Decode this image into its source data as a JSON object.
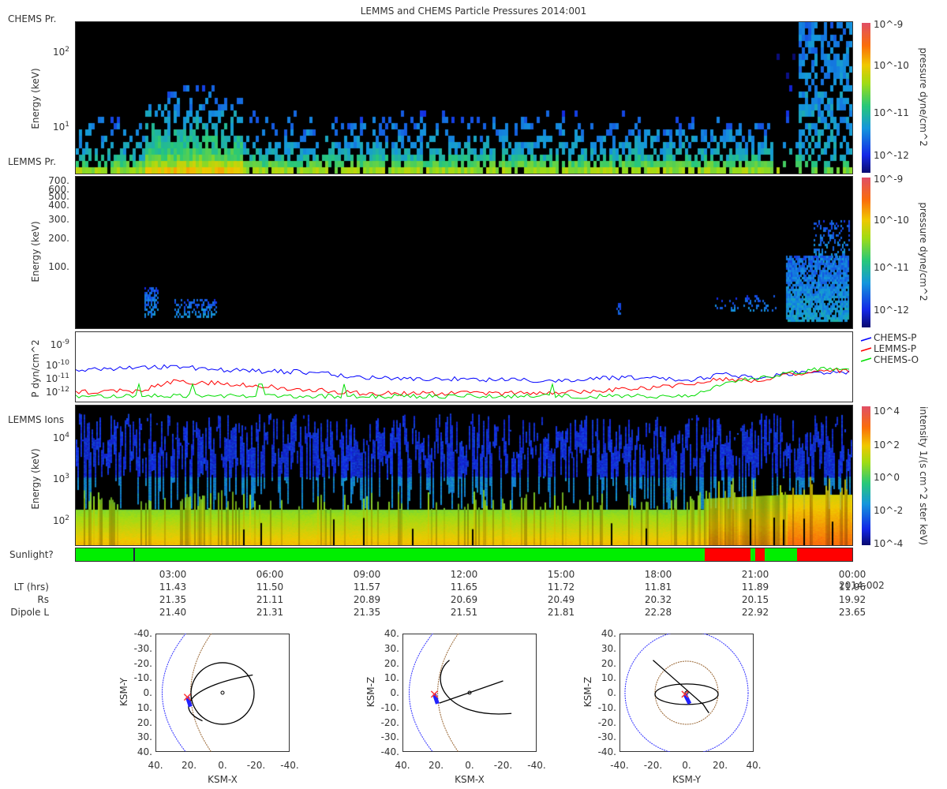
{
  "title": "LEMMS and CHEMS Particle Pressures  2014:001",
  "colors": {
    "sunlit": "#00ee00",
    "eclipse": "#ff0000",
    "chems_p": "#0000ff",
    "lemms_p": "#ff0000",
    "chems_o": "#00dd00"
  },
  "chart_data": [
    {
      "type": "heatmap",
      "panel_label": "CHEMS Pr.",
      "ylabel": "Energy (keV)",
      "yticks": [
        "10^2",
        "10^1"
      ],
      "colorbar_label": "pressure dyne/cm^2",
      "colorbar_ticks": [
        "10^-9",
        "10^-10",
        "10^-11",
        "10^-12"
      ],
      "zlim": [
        1e-12,
        1e-09
      ]
    },
    {
      "type": "heatmap",
      "panel_label": "LEMMS Pr.",
      "ylabel": "Energy (keV)",
      "yticks": [
        "700.",
        "600.",
        "500.",
        "400.",
        "300.",
        "200.",
        "100."
      ],
      "colorbar_label": "pressure dyne/cm^2",
      "colorbar_ticks": [
        "10^-9",
        "10^-10",
        "10^-11",
        "10^-12"
      ],
      "zlim": [
        1e-12,
        1e-09
      ]
    },
    {
      "type": "line",
      "ylabel": "P dyn/cm^2",
      "yticks": [
        "10^-9",
        "10^-10",
        "10^-11",
        "10^-12"
      ],
      "ylim": [
        5e-13,
        3e-09
      ],
      "x_hours": [
        0,
        2,
        3,
        5,
        7,
        9,
        11,
        13,
        15,
        17,
        18,
        19,
        20,
        21,
        22,
        23,
        24
      ],
      "series": [
        {
          "name": "CHEMS-P",
          "log10_values": [
            -10.3,
            -10.2,
            -10.1,
            -10.4,
            -10.5,
            -10.9,
            -11.0,
            -11.1,
            -11.1,
            -10.9,
            -10.9,
            -11.2,
            -10.6,
            -11.0,
            -10.6,
            -10.6,
            -10.5
          ]
        },
        {
          "name": "LEMMS-P",
          "log10_values": [
            -12.0,
            -11.9,
            -11.2,
            -11.4,
            -11.8,
            -12.1,
            -12.1,
            -12.1,
            -12.0,
            -11.8,
            -11.6,
            -11.4,
            -11.0,
            -11.2,
            -10.7,
            -10.4,
            -10.4
          ]
        },
        {
          "name": "CHEMS-O",
          "log10_values": [
            -12.3,
            -12.3,
            -12.3,
            -12.3,
            -12.3,
            -12.3,
            -12.3,
            -12.3,
            -12.3,
            -12.3,
            -12.3,
            -12.3,
            -11.3,
            -11.0,
            -10.6,
            -10.3,
            -10.2
          ]
        }
      ]
    },
    {
      "type": "heatmap",
      "panel_label": "LEMMS Ions",
      "ylabel": "Energy (keV)",
      "yticks": [
        "10^4",
        "10^3",
        "10^2"
      ],
      "colorbar_label": "intensity 1/(s cm^2 ster keV)",
      "colorbar_ticks": [
        "10^4",
        "10^2",
        "10^0",
        "10^-2",
        "10^-4"
      ],
      "zlim": [
        1e-05,
        10000.0
      ]
    }
  ],
  "sunlight": {
    "label": "Sunlight?",
    "segments_hours": [
      [
        0,
        19.45,
        "sunlit"
      ],
      [
        19.45,
        20.85,
        "eclipse"
      ],
      [
        20.85,
        21.0,
        "sunlit"
      ],
      [
        21.0,
        21.3,
        "eclipse"
      ],
      [
        21.3,
        22.3,
        "sunlit"
      ],
      [
        22.3,
        24,
        "eclipse"
      ]
    ]
  },
  "xaxis": {
    "ticks": [
      "03:00",
      "06:00",
      "09:00",
      "12:00",
      "15:00",
      "18:00",
      "21:00",
      "00:00"
    ],
    "end_date": "2014-002",
    "rows": [
      {
        "label": "LT (hrs)",
        "values": [
          "11.43",
          "11.50",
          "11.57",
          "11.65",
          "11.72",
          "11.81",
          "11.89",
          "11.96"
        ]
      },
      {
        "label": "Rs",
        "values": [
          "21.35",
          "21.11",
          "20.89",
          "20.69",
          "20.49",
          "20.32",
          "20.15",
          "19.92"
        ]
      },
      {
        "label": "Dipole L",
        "values": [
          "21.40",
          "21.31",
          "21.35",
          "21.51",
          "21.81",
          "22.28",
          "22.92",
          "23.65"
        ]
      }
    ]
  },
  "orbits": [
    {
      "xlabel": "KSM-X",
      "ylabel": "KSM-Y",
      "xticks": [
        "40.",
        "20.",
        "0.",
        "-20.",
        "-40."
      ],
      "yticks": [
        "-40.",
        "-30.",
        "-20.",
        "-10.",
        "0.",
        "10.",
        "20.",
        "30.",
        "40."
      ]
    },
    {
      "xlabel": "KSM-X",
      "ylabel": "KSM-Z",
      "xticks": [
        "40.",
        "20.",
        "0.",
        "-20.",
        "-40."
      ],
      "yticks": [
        "40.",
        "30.",
        "20.",
        "10.",
        "0.",
        "-10.",
        "-20.",
        "-30.",
        "-40."
      ]
    },
    {
      "xlabel": "KSM-Y",
      "ylabel": "KSM-Z",
      "xticks": [
        "-40.",
        "-20.",
        "0.",
        "20.",
        "40."
      ],
      "yticks": [
        "40.",
        "30.",
        "20.",
        "10.",
        "0.",
        "-10.",
        "-20.",
        "-30.",
        "-40."
      ]
    }
  ]
}
